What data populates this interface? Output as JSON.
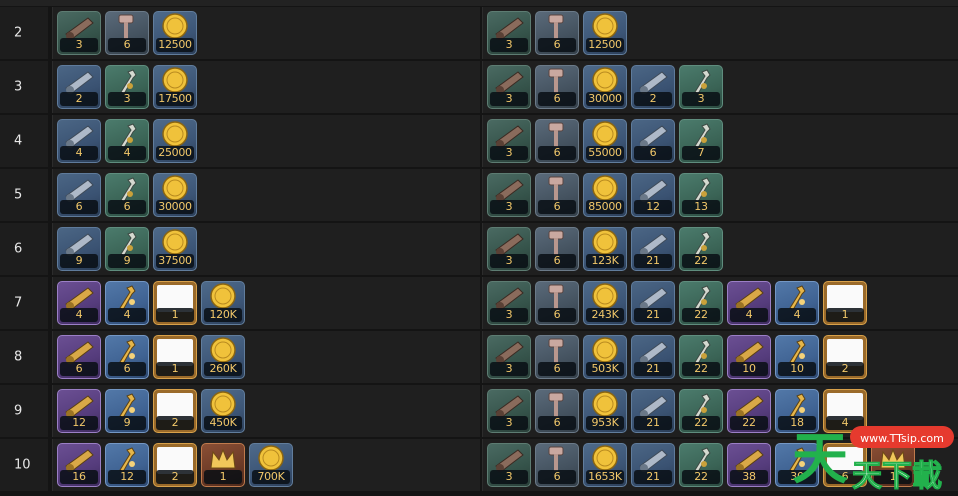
{
  "rows": [
    {
      "level": "2",
      "left": [
        {
          "type": "cannon",
          "qty": "3"
        },
        {
          "type": "hammer",
          "qty": "6"
        },
        {
          "type": "gold",
          "qty": "12500"
        }
      ],
      "right": [
        {
          "type": "cannon",
          "qty": "3"
        },
        {
          "type": "hammer",
          "qty": "6"
        },
        {
          "type": "gold",
          "qty": "12500"
        }
      ]
    },
    {
      "level": "3",
      "left": [
        {
          "type": "cannonB",
          "qty": "2"
        },
        {
          "type": "wrenchG",
          "qty": "3"
        },
        {
          "type": "gold",
          "qty": "17500"
        }
      ],
      "right": [
        {
          "type": "cannon",
          "qty": "3"
        },
        {
          "type": "hammer",
          "qty": "6"
        },
        {
          "type": "gold",
          "qty": "30000"
        },
        {
          "type": "cannonB",
          "qty": "2"
        },
        {
          "type": "wrenchG",
          "qty": "3"
        }
      ]
    },
    {
      "level": "4",
      "left": [
        {
          "type": "cannonB",
          "qty": "4"
        },
        {
          "type": "wrenchG",
          "qty": "4"
        },
        {
          "type": "gold",
          "qty": "25000"
        }
      ],
      "right": [
        {
          "type": "cannon",
          "qty": "3"
        },
        {
          "type": "hammer",
          "qty": "6"
        },
        {
          "type": "gold",
          "qty": "55000"
        },
        {
          "type": "cannonB",
          "qty": "6"
        },
        {
          "type": "wrenchG",
          "qty": "7"
        }
      ]
    },
    {
      "level": "5",
      "left": [
        {
          "type": "cannonB",
          "qty": "6"
        },
        {
          "type": "wrenchG",
          "qty": "6"
        },
        {
          "type": "gold",
          "qty": "30000"
        }
      ],
      "right": [
        {
          "type": "cannon",
          "qty": "3"
        },
        {
          "type": "hammer",
          "qty": "6"
        },
        {
          "type": "gold",
          "qty": "85000"
        },
        {
          "type": "cannonB",
          "qty": "12"
        },
        {
          "type": "wrenchG",
          "qty": "13"
        }
      ]
    },
    {
      "level": "6",
      "left": [
        {
          "type": "cannonB",
          "qty": "9"
        },
        {
          "type": "wrenchG",
          "qty": "9"
        },
        {
          "type": "gold",
          "qty": "37500"
        }
      ],
      "right": [
        {
          "type": "cannon",
          "qty": "3"
        },
        {
          "type": "hammer",
          "qty": "6"
        },
        {
          "type": "gold",
          "qty": "123K"
        },
        {
          "type": "cannonB",
          "qty": "21"
        },
        {
          "type": "wrenchG",
          "qty": "22"
        }
      ]
    },
    {
      "level": "7",
      "left": [
        {
          "type": "cannonP",
          "qty": "4"
        },
        {
          "type": "wrenchB",
          "qty": "4"
        },
        {
          "type": "blank",
          "qty": "1"
        },
        {
          "type": "gold",
          "qty": "120K"
        }
      ],
      "right": [
        {
          "type": "cannon",
          "qty": "3"
        },
        {
          "type": "hammer",
          "qty": "6"
        },
        {
          "type": "gold",
          "qty": "243K"
        },
        {
          "type": "cannonB",
          "qty": "21"
        },
        {
          "type": "wrenchG",
          "qty": "22"
        },
        {
          "type": "cannonP",
          "qty": "4"
        },
        {
          "type": "wrenchB",
          "qty": "4"
        },
        {
          "type": "blank",
          "qty": "1"
        }
      ]
    },
    {
      "level": "8",
      "left": [
        {
          "type": "cannonP",
          "qty": "6"
        },
        {
          "type": "wrenchB",
          "qty": "6"
        },
        {
          "type": "blank",
          "qty": "1"
        },
        {
          "type": "gold",
          "qty": "260K"
        }
      ],
      "right": [
        {
          "type": "cannon",
          "qty": "3"
        },
        {
          "type": "hammer",
          "qty": "6"
        },
        {
          "type": "gold",
          "qty": "503K"
        },
        {
          "type": "cannonB",
          "qty": "21"
        },
        {
          "type": "wrenchG",
          "qty": "22"
        },
        {
          "type": "cannonP",
          "qty": "10"
        },
        {
          "type": "wrenchB",
          "qty": "10"
        },
        {
          "type": "blank",
          "qty": "2"
        }
      ]
    },
    {
      "level": "9",
      "left": [
        {
          "type": "cannonP",
          "qty": "12"
        },
        {
          "type": "wrenchB",
          "qty": "9"
        },
        {
          "type": "blank",
          "qty": "2"
        },
        {
          "type": "gold",
          "qty": "450K"
        }
      ],
      "right": [
        {
          "type": "cannon",
          "qty": "3"
        },
        {
          "type": "hammer",
          "qty": "6"
        },
        {
          "type": "gold",
          "qty": "953K"
        },
        {
          "type": "cannonB",
          "qty": "21"
        },
        {
          "type": "wrenchG",
          "qty": "22"
        },
        {
          "type": "cannonP",
          "qty": "22"
        },
        {
          "type": "wrenchB",
          "qty": "18"
        },
        {
          "type": "blank",
          "qty": "4"
        }
      ]
    },
    {
      "level": "10",
      "left": [
        {
          "type": "cannonP",
          "qty": "16"
        },
        {
          "type": "wrenchB",
          "qty": "12"
        },
        {
          "type": "blank",
          "qty": "2"
        },
        {
          "type": "crown",
          "qty": "1"
        },
        {
          "type": "gold",
          "qty": "700K"
        }
      ],
      "right": [
        {
          "type": "cannon",
          "qty": "3"
        },
        {
          "type": "hammer",
          "qty": "6"
        },
        {
          "type": "gold",
          "qty": "1653K"
        },
        {
          "type": "cannonB",
          "qty": "21"
        },
        {
          "type": "wrenchG",
          "qty": "22"
        },
        {
          "type": "cannonP",
          "qty": "38"
        },
        {
          "type": "wrenchB",
          "qty": "30"
        },
        {
          "type": "blank",
          "qty": "6"
        },
        {
          "type": "crown",
          "qty": "1"
        }
      ]
    }
  ],
  "watermark": {
    "site": "www.TTsip.com",
    "char1": "天",
    "brand": "天下載"
  },
  "icons": {
    "cannon": "cannon-icon",
    "hammer": "hammer-icon",
    "cannonB": "blue-cannon-icon",
    "wrenchG": "wrench-icon",
    "gold": "gold-coin-icon",
    "cannonP": "purple-cannon-icon",
    "wrenchB": "gold-wrench-icon",
    "blank": "blank-card-icon",
    "crown": "crown-icon"
  }
}
